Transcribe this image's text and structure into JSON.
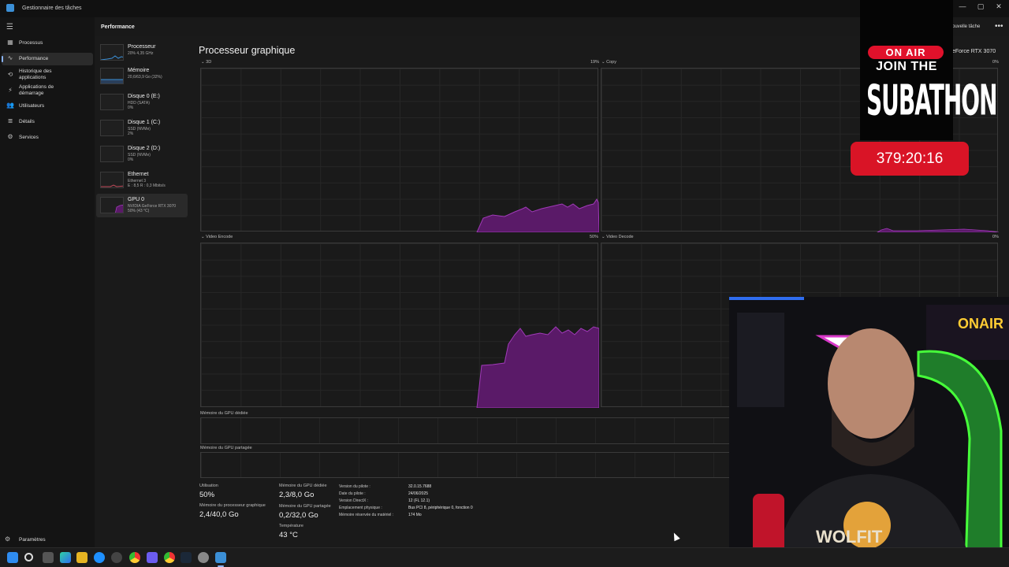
{
  "window": {
    "title": "Gestionnaire des tâches",
    "controls": [
      "—",
      "▢",
      "✕"
    ]
  },
  "nav": {
    "items": [
      {
        "label": "Processus",
        "icon": "grid-icon"
      },
      {
        "label": "Performance",
        "icon": "pulse-icon",
        "active": true
      },
      {
        "label": "Historique des applications",
        "icon": "history-icon"
      },
      {
        "label": "Applications de démarrage",
        "icon": "startup-icon"
      },
      {
        "label": "Utilisateurs",
        "icon": "users-icon"
      },
      {
        "label": "Détails",
        "icon": "list-icon"
      },
      {
        "label": "Services",
        "icon": "services-icon"
      }
    ],
    "settings_label": "Paramètres"
  },
  "header": {
    "section_title": "Performance",
    "new_task_label": "ouvelle tâche",
    "more_label": "•••"
  },
  "devices": [
    {
      "name": "Processeur",
      "s1": "20% 4,35 GHz",
      "s2": ""
    },
    {
      "name": "Mémoire",
      "s1": "20,6/63,9 Go (32%)",
      "s2": ""
    },
    {
      "name": "Disque 0 (E:)",
      "s1": "HDD (SATA)",
      "s2": "0%"
    },
    {
      "name": "Disque 1 (C:)",
      "s1": "SSD (NVMe)",
      "s2": "2%"
    },
    {
      "name": "Disque 2 (D:)",
      "s1": "SSD (NVMe)",
      "s2": "0%"
    },
    {
      "name": "Ethernet",
      "s1": "Ethernet 3",
      "s2": "E : 8,5 R : 0,3 Mbits/s"
    },
    {
      "name": "GPU 0",
      "s1": "NVIDIA GeForce RTX 3070",
      "s2": "50% (43 °C)",
      "selected": true
    }
  ],
  "main": {
    "title": "Processeur graphique",
    "gpu_model": "eForce RTX 3070"
  },
  "graphs": [
    {
      "name": "3D",
      "max": "19%"
    },
    {
      "name": "Copy",
      "max": "0%"
    },
    {
      "name": "Video Encode",
      "max": "50%"
    },
    {
      "name": "Video Decode",
      "max": "0%"
    }
  ],
  "memory_bars": {
    "dedicated_label": "Mémoire du GPU dédiée",
    "shared_label": "Mémoire du GPU partagée"
  },
  "stats": {
    "utilisation_label": "Utilisation",
    "utilisation_value": "50%",
    "gpu_proc_mem_label": "Mémoire du processeur graphique",
    "gpu_proc_mem_value": "2,4/40,0 Go",
    "dedicated_label": "Mémoire du GPU dédiée",
    "dedicated_value": "2,3/8,0 Go",
    "shared_label": "Mémoire du GPU partagée",
    "shared_value": "0,2/32,0 Go",
    "temp_label": "Température",
    "temp_value": "43 °C"
  },
  "info": [
    {
      "key": "Version du pilote :",
      "value": "32.0.15.7688"
    },
    {
      "key": "Date du pilote :",
      "value": "24/06/2025"
    },
    {
      "key": "Version DirectX :",
      "value": "12 (FL 12.1)"
    },
    {
      "key": "Emplacement physique :",
      "value": "Bus PCI 8, périphérique 0, fonction 0"
    },
    {
      "key": "Mémoire réservée du matériel :",
      "value": "174 Mo"
    }
  ],
  "overlay": {
    "on_air": "ON AIR",
    "join": "JOIN THE",
    "subathon": "SUBATHON",
    "timer": "379:20:16"
  },
  "colors": {
    "gpu_graph": "#8a2a9e",
    "gpu_graph_fill": "#5a1a68",
    "accent": "#8ab4f8",
    "live_red": "#d91426"
  }
}
